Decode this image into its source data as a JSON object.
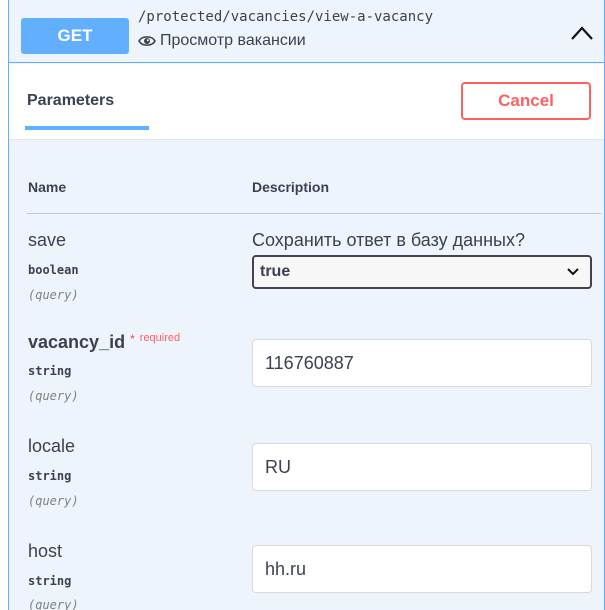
{
  "operation": {
    "method": "GET",
    "path": "/protected/vacancies/view-a-vacancy",
    "summary": "Просмотр вакансии",
    "summary_icon": "eye-icon",
    "collapse_icon": "chevron-up-icon"
  },
  "section": {
    "tab_label": "Parameters",
    "cancel_label": "Cancel"
  },
  "table": {
    "col_name": "Name",
    "col_description": "Description"
  },
  "params": [
    {
      "name": "save",
      "type": "boolean",
      "in": "(query)",
      "description": "Сохранить ответ в базу данных?",
      "selected": "true",
      "options": [
        "true"
      ]
    },
    {
      "name": "vacancy_id",
      "required_mark": "*",
      "required_label": "required",
      "type": "string",
      "in": "(query)",
      "value": "116760887"
    },
    {
      "name": "locale",
      "type": "string",
      "in": "(query)",
      "value": "RU"
    },
    {
      "name": "host",
      "type": "string",
      "in": "(query)",
      "value": "hh.ru"
    }
  ],
  "colors": {
    "get_accent": "#61affe",
    "panel_bg": "#eef4fc",
    "cancel": "#ff6060",
    "required": "#ff4040"
  }
}
